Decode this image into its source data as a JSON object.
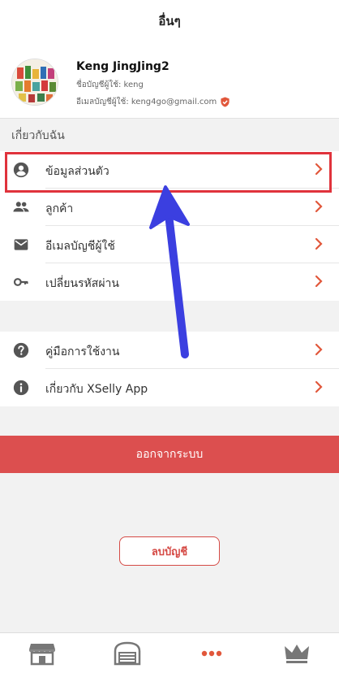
{
  "header": {
    "title": "อื่นๆ"
  },
  "profile": {
    "name": "Keng JingJing2",
    "username_line": "ชื่อบัญชีผู้ใช้: keng",
    "email_line": "อีเมลบัญชีผู้ใช้: keng4go@gmail.com"
  },
  "section": {
    "about_me": "เกี่ยวกับฉัน"
  },
  "menu_account": [
    {
      "label": "ข้อมูลส่วนตัว",
      "icon": "person-circle-icon"
    },
    {
      "label": "ลูกค้า",
      "icon": "people-icon"
    },
    {
      "label": "อีเมลบัญชีผู้ใช้",
      "icon": "mail-icon"
    },
    {
      "label": "เปลี่ยนรหัสผ่าน",
      "icon": "key-icon"
    }
  ],
  "menu_help": [
    {
      "label": "คู่มือการใช้งาน",
      "icon": "help-circle-icon"
    },
    {
      "label": "เกี่ยวกับ XSelly App",
      "icon": "info-circle-icon"
    }
  ],
  "buttons": {
    "logout": "ออกจากระบบ",
    "delete_account": "ลบบัญชี"
  },
  "tabs": [
    {
      "icon": "store-icon"
    },
    {
      "icon": "warehouse-icon"
    },
    {
      "icon": "more-dots-icon",
      "active": true
    },
    {
      "icon": "crown-icon"
    }
  ],
  "colors": {
    "accent": "#e1573b",
    "logout_bg": "#dc4f4f",
    "highlight": "#e0333c",
    "annotation_arrow": "#3b3fe0"
  }
}
